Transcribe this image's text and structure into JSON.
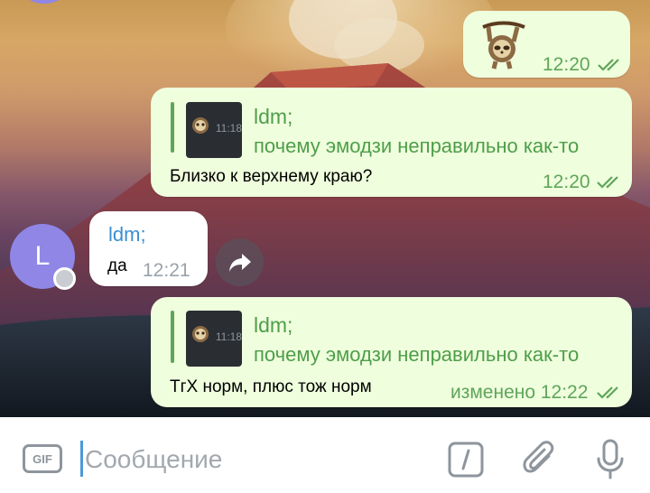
{
  "messages": {
    "sticker": {
      "time": "12:20"
    },
    "reply1": {
      "thumb_time": "11:18",
      "reply_name": "ldm;",
      "reply_text": "почему эмодзи неправильно как-то",
      "text": "Близко к верхнему краю?",
      "time": "12:20"
    },
    "incoming": {
      "avatar_letter": "L",
      "sender": "ldm;",
      "text": "да",
      "time": "12:21"
    },
    "reply2": {
      "thumb_time": "11:18",
      "reply_name": "ldm;",
      "reply_text": "почему эмодзи неправильно как-то",
      "text": "ТгХ норм, плюс тож норм",
      "edited_time": "изменено 12:22"
    }
  },
  "input_bar": {
    "gif_label": "GIF",
    "placeholder": "Сообщение",
    "icons": [
      "gif-icon",
      "bot-command-icon",
      "attach-icon",
      "microphone-icon"
    ]
  },
  "colors": {
    "outgoing_bubble": "#effedd",
    "incoming_bubble": "#ffffff",
    "accent_green": "#5fa55a",
    "sender_blue": "#3a8fd1",
    "avatar": "#8f86e6"
  }
}
